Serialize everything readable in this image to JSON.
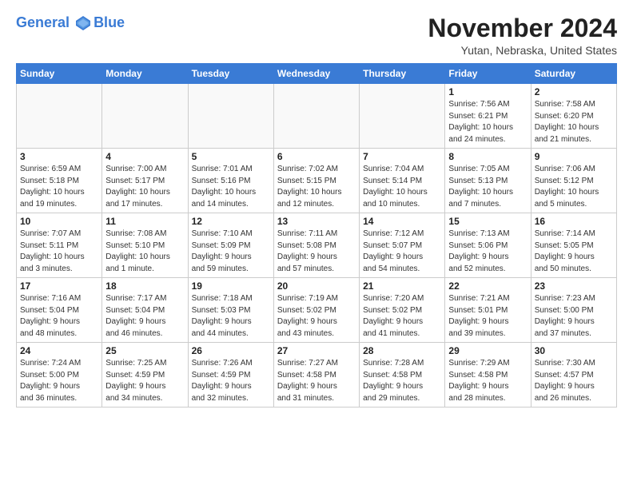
{
  "logo": {
    "line1": "General",
    "line2": "Blue"
  },
  "title": "November 2024",
  "location": "Yutan, Nebraska, United States",
  "weekdays": [
    "Sunday",
    "Monday",
    "Tuesday",
    "Wednesday",
    "Thursday",
    "Friday",
    "Saturday"
  ],
  "weeks": [
    [
      {
        "day": "",
        "info": ""
      },
      {
        "day": "",
        "info": ""
      },
      {
        "day": "",
        "info": ""
      },
      {
        "day": "",
        "info": ""
      },
      {
        "day": "",
        "info": ""
      },
      {
        "day": "1",
        "info": "Sunrise: 7:56 AM\nSunset: 6:21 PM\nDaylight: 10 hours\nand 24 minutes."
      },
      {
        "day": "2",
        "info": "Sunrise: 7:58 AM\nSunset: 6:20 PM\nDaylight: 10 hours\nand 21 minutes."
      }
    ],
    [
      {
        "day": "3",
        "info": "Sunrise: 6:59 AM\nSunset: 5:18 PM\nDaylight: 10 hours\nand 19 minutes."
      },
      {
        "day": "4",
        "info": "Sunrise: 7:00 AM\nSunset: 5:17 PM\nDaylight: 10 hours\nand 17 minutes."
      },
      {
        "day": "5",
        "info": "Sunrise: 7:01 AM\nSunset: 5:16 PM\nDaylight: 10 hours\nand 14 minutes."
      },
      {
        "day": "6",
        "info": "Sunrise: 7:02 AM\nSunset: 5:15 PM\nDaylight: 10 hours\nand 12 minutes."
      },
      {
        "day": "7",
        "info": "Sunrise: 7:04 AM\nSunset: 5:14 PM\nDaylight: 10 hours\nand 10 minutes."
      },
      {
        "day": "8",
        "info": "Sunrise: 7:05 AM\nSunset: 5:13 PM\nDaylight: 10 hours\nand 7 minutes."
      },
      {
        "day": "9",
        "info": "Sunrise: 7:06 AM\nSunset: 5:12 PM\nDaylight: 10 hours\nand 5 minutes."
      }
    ],
    [
      {
        "day": "10",
        "info": "Sunrise: 7:07 AM\nSunset: 5:11 PM\nDaylight: 10 hours\nand 3 minutes."
      },
      {
        "day": "11",
        "info": "Sunrise: 7:08 AM\nSunset: 5:10 PM\nDaylight: 10 hours\nand 1 minute."
      },
      {
        "day": "12",
        "info": "Sunrise: 7:10 AM\nSunset: 5:09 PM\nDaylight: 9 hours\nand 59 minutes."
      },
      {
        "day": "13",
        "info": "Sunrise: 7:11 AM\nSunset: 5:08 PM\nDaylight: 9 hours\nand 57 minutes."
      },
      {
        "day": "14",
        "info": "Sunrise: 7:12 AM\nSunset: 5:07 PM\nDaylight: 9 hours\nand 54 minutes."
      },
      {
        "day": "15",
        "info": "Sunrise: 7:13 AM\nSunset: 5:06 PM\nDaylight: 9 hours\nand 52 minutes."
      },
      {
        "day": "16",
        "info": "Sunrise: 7:14 AM\nSunset: 5:05 PM\nDaylight: 9 hours\nand 50 minutes."
      }
    ],
    [
      {
        "day": "17",
        "info": "Sunrise: 7:16 AM\nSunset: 5:04 PM\nDaylight: 9 hours\nand 48 minutes."
      },
      {
        "day": "18",
        "info": "Sunrise: 7:17 AM\nSunset: 5:04 PM\nDaylight: 9 hours\nand 46 minutes."
      },
      {
        "day": "19",
        "info": "Sunrise: 7:18 AM\nSunset: 5:03 PM\nDaylight: 9 hours\nand 44 minutes."
      },
      {
        "day": "20",
        "info": "Sunrise: 7:19 AM\nSunset: 5:02 PM\nDaylight: 9 hours\nand 43 minutes."
      },
      {
        "day": "21",
        "info": "Sunrise: 7:20 AM\nSunset: 5:02 PM\nDaylight: 9 hours\nand 41 minutes."
      },
      {
        "day": "22",
        "info": "Sunrise: 7:21 AM\nSunset: 5:01 PM\nDaylight: 9 hours\nand 39 minutes."
      },
      {
        "day": "23",
        "info": "Sunrise: 7:23 AM\nSunset: 5:00 PM\nDaylight: 9 hours\nand 37 minutes."
      }
    ],
    [
      {
        "day": "24",
        "info": "Sunrise: 7:24 AM\nSunset: 5:00 PM\nDaylight: 9 hours\nand 36 minutes."
      },
      {
        "day": "25",
        "info": "Sunrise: 7:25 AM\nSunset: 4:59 PM\nDaylight: 9 hours\nand 34 minutes."
      },
      {
        "day": "26",
        "info": "Sunrise: 7:26 AM\nSunset: 4:59 PM\nDaylight: 9 hours\nand 32 minutes."
      },
      {
        "day": "27",
        "info": "Sunrise: 7:27 AM\nSunset: 4:58 PM\nDaylight: 9 hours\nand 31 minutes."
      },
      {
        "day": "28",
        "info": "Sunrise: 7:28 AM\nSunset: 4:58 PM\nDaylight: 9 hours\nand 29 minutes."
      },
      {
        "day": "29",
        "info": "Sunrise: 7:29 AM\nSunset: 4:58 PM\nDaylight: 9 hours\nand 28 minutes."
      },
      {
        "day": "30",
        "info": "Sunrise: 7:30 AM\nSunset: 4:57 PM\nDaylight: 9 hours\nand 26 minutes."
      }
    ]
  ]
}
